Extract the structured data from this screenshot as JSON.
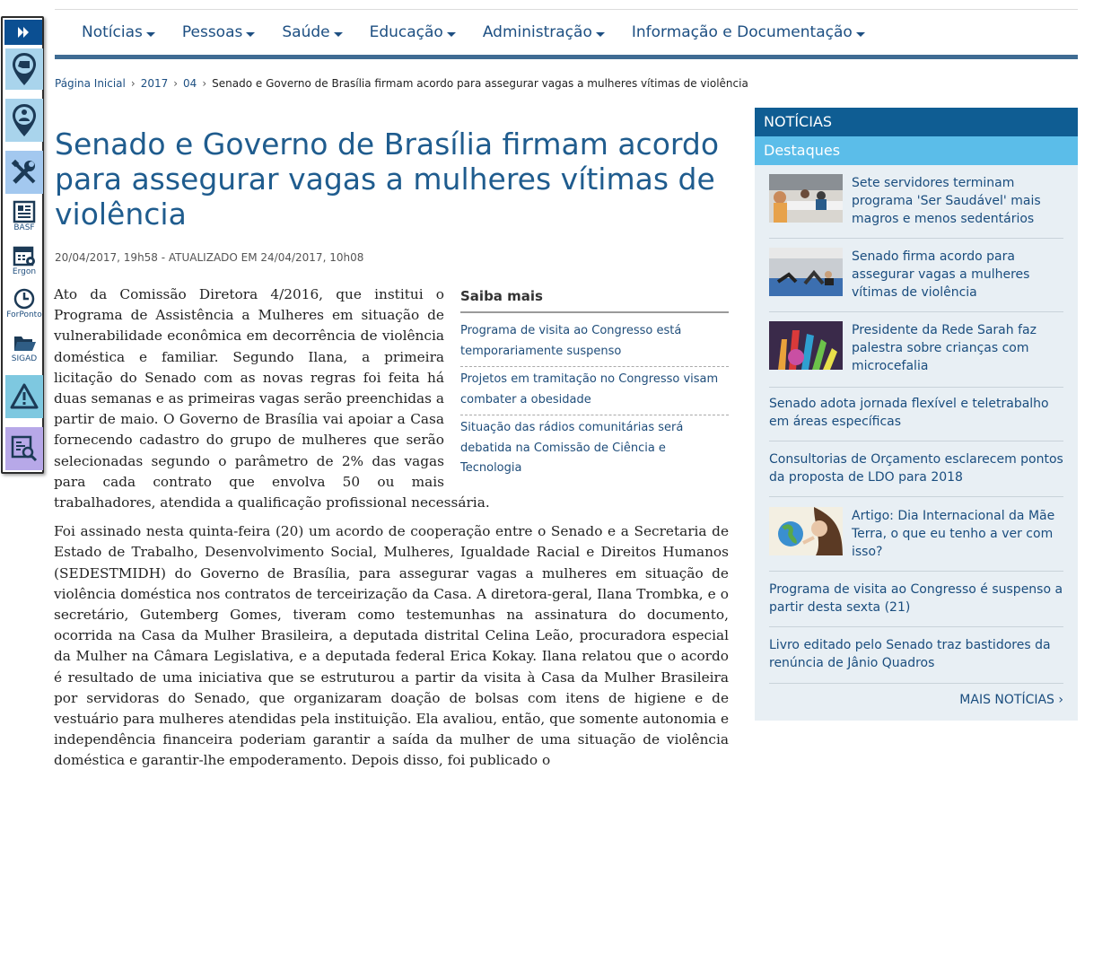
{
  "sidebar_tools": [
    {
      "icon": "map-pin-chat-icon",
      "label": ""
    },
    {
      "icon": "map-pin-person-icon",
      "label": ""
    },
    {
      "icon": "tools-icon",
      "label": ""
    },
    {
      "icon": "newspaper-icon",
      "label": "BASF"
    },
    {
      "icon": "calendar-gear-icon",
      "label": "Ergon"
    },
    {
      "icon": "clock-icon",
      "label": "ForPonto"
    },
    {
      "icon": "folder-open-icon",
      "label": "SIGAD"
    },
    {
      "icon": "warning-icon",
      "label": ""
    },
    {
      "icon": "document-search-icon",
      "label": ""
    }
  ],
  "nav": [
    "Notícias",
    "Pessoas",
    "Saúde",
    "Educação",
    "Administração",
    "Informação e Documentação"
  ],
  "breadcrumb": {
    "home": "Página Inicial",
    "year": "2017",
    "month": "04",
    "current": "Senado e Governo de Brasília firmam acordo para assegurar vagas a mulheres vítimas de violência",
    "sep": "›"
  },
  "article": {
    "title": "Senado e Governo de Brasília firmam acordo para assegurar vagas a mulheres vítimas de violência",
    "meta": "20/04/2017, 19h58 - ATUALIZADO EM 24/04/2017, 10h08",
    "p1": "Ato da Comissão Diretora 4/2016, que institui o Programa de Assistência a Mulheres em situação de vulnerabilidade econômica em decorrência de violência doméstica e familiar. Segundo Ilana, a primeira licitação do Senado com as novas regras foi feita há duas semanas e as primeiras vagas serão preenchidas a partir de maio. O Governo de Brasília vai apoiar a Casa fornecendo cadastro do grupo de mulheres que serão selecionadas segundo o parâmetro de 2% das vagas para cada contrato que envolva 50 ou mais trabalhadores, atendida a qualificação profissional necessária.",
    "p2": "Foi assinado nesta quinta-feira (20) um acordo de cooperação entre o Senado e a Secretaria de Estado de Trabalho, Desenvolvimento Social, Mulheres, Igualdade Racial e Direitos Humanos (SEDESTMIDH) do Governo de Brasília, para assegurar vagas a mulheres em situação de violência doméstica nos contratos de terceirização da Casa. A diretora-geral, Ilana Trombka, e o secretário, Gutemberg Gomes, tiveram como testemunhas na assinatura do documento, ocorrida na Casa da Mulher Brasileira, a deputada distrital Celina Leão, procuradora especial da Mulher na Câmara Legislativa, e a deputada federal Erica Kokay. Ilana relatou que o acordo é resultado de uma iniciativa que se estruturou a partir da visita à Casa da Mulher Brasileira por servidoras do Senado, que organizaram doação de bolsas com itens de higiene e de vestuário para mulheres atendidas pela instituição. Ela avaliou, então, que somente autonomia e independência financeira poderiam garantir a saída da mulher de uma situação de violência doméstica e garantir-lhe empoderamento. Depois disso, foi publicado o"
  },
  "saiba_mais": {
    "title": "Saiba mais",
    "items": [
      "Programa de visita ao Congresso está temporariamente suspenso",
      "Projetos em tramitação no Congresso visam combater a obesidade",
      "Situação das rádios comunitárias será debatida na Comissão de Ciência e Tecnologia"
    ]
  },
  "sidebar_news": {
    "header": "NOTÍCIAS",
    "subheader": "Destaques",
    "items": [
      {
        "text": "Sete servidores terminam programa 'Ser Saudável' mais magros e menos sedentários",
        "image": "photo-meeting-table"
      },
      {
        "text": "Senado firma acordo para assegurar vagas a mulheres vítimas de violência",
        "image": "photo-gym-class"
      },
      {
        "text": "Presidente da Rede Sarah faz palestra sobre crianças com microcefalia",
        "image": "photo-painted-hands"
      },
      {
        "text": "Senado adota jornada flexível e teletrabalho em áreas específicas"
      },
      {
        "text": "Consultorias de Orçamento esclarecem pontos da proposta de LDO para 2018"
      },
      {
        "text": "Artigo: Dia Internacional da Mãe Terra, o que eu tenho a ver com isso?",
        "image": "illustration-earth-woman"
      },
      {
        "text": "Programa de visita ao Congresso é suspenso a partir desta sexta (21)"
      },
      {
        "text": "Livro editado pelo Senado traz bastidores da renúncia de Jânio Quadros"
      }
    ],
    "more": "MAIS NOTÍCIAS ›"
  }
}
